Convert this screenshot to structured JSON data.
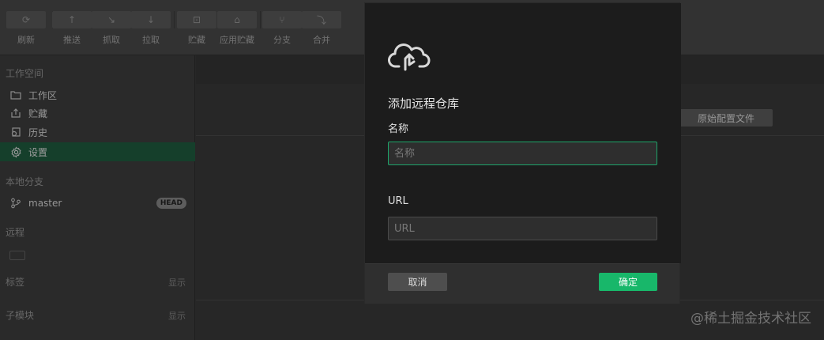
{
  "toolbar": {
    "buttons": [
      {
        "label": "刷新",
        "icon": "refresh-icon"
      },
      {
        "label": "推送",
        "icon": "push-icon"
      },
      {
        "label": "抓取",
        "icon": "fetch-icon"
      },
      {
        "label": "拉取",
        "icon": "pull-icon"
      },
      {
        "label": "贮藏",
        "icon": "stash-icon"
      },
      {
        "label": "应用贮藏",
        "icon": "apply-stash-icon"
      },
      {
        "label": "分支",
        "icon": "branch-icon"
      },
      {
        "label": "合并",
        "icon": "merge-icon"
      }
    ]
  },
  "sidebar": {
    "workspace_title": "工作空间",
    "workspace_items": [
      {
        "label": "工作区",
        "icon": "folder-icon"
      },
      {
        "label": "贮藏",
        "icon": "stash-icon"
      },
      {
        "label": "历史",
        "icon": "history-icon"
      },
      {
        "label": "设置",
        "icon": "gear-icon",
        "active": true
      }
    ],
    "local_branches_title": "本地分支",
    "branch": {
      "name": "master",
      "badge": "HEAD"
    },
    "remote_title": "远程",
    "tags_title": "标签",
    "tags_action": "显示",
    "submodules_title": "子模块",
    "submodules_action": "显示"
  },
  "main": {
    "orig_config_button": "原始配置文件",
    "watermark": "@稀土掘金技术社区"
  },
  "modal": {
    "icon": "cloud-upload-icon",
    "title": "添加远程仓库",
    "name_label": "名称",
    "name_placeholder": "名称",
    "name_value": "",
    "url_label": "URL",
    "url_placeholder": "URL",
    "url_value": "",
    "cancel_label": "取消",
    "ok_label": "确定",
    "accent_color": "#18b76a"
  }
}
